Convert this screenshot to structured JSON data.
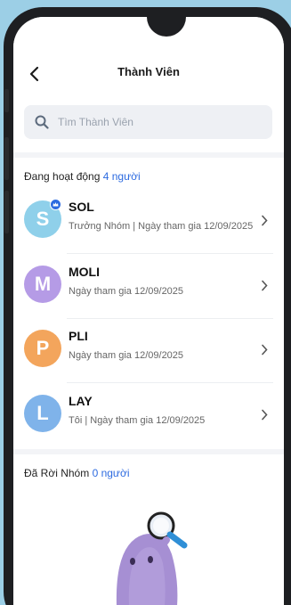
{
  "header": {
    "title": "Thành Viên"
  },
  "search": {
    "placeholder": "Tìm Thành Viên"
  },
  "active_section": {
    "label": "Đang hoạt động",
    "count": "4 người"
  },
  "members": [
    {
      "name": "SOL",
      "subtitle": "Trưởng Nhóm | Ngày tham gia 12/09/2025",
      "initial": "S",
      "color": "#8fd0ea"
    },
    {
      "name": "MOLI",
      "subtitle": "Ngày tham gia 12/09/2025",
      "initial": "M",
      "color": "#b59be6"
    },
    {
      "name": "PLI",
      "subtitle": "Ngày tham gia 12/09/2025",
      "initial": "P",
      "color": "#f3a55c"
    },
    {
      "name": "LAY",
      "subtitle": "Tôi | Ngày tham gia 12/09/2025",
      "initial": "L",
      "color": "#7fb3ea"
    }
  ],
  "left_section": {
    "label": "Đã Rời Nhóm",
    "count": "0 người"
  },
  "colors": {
    "accent": "#2d6be0",
    "background": "#9ccfe6"
  }
}
